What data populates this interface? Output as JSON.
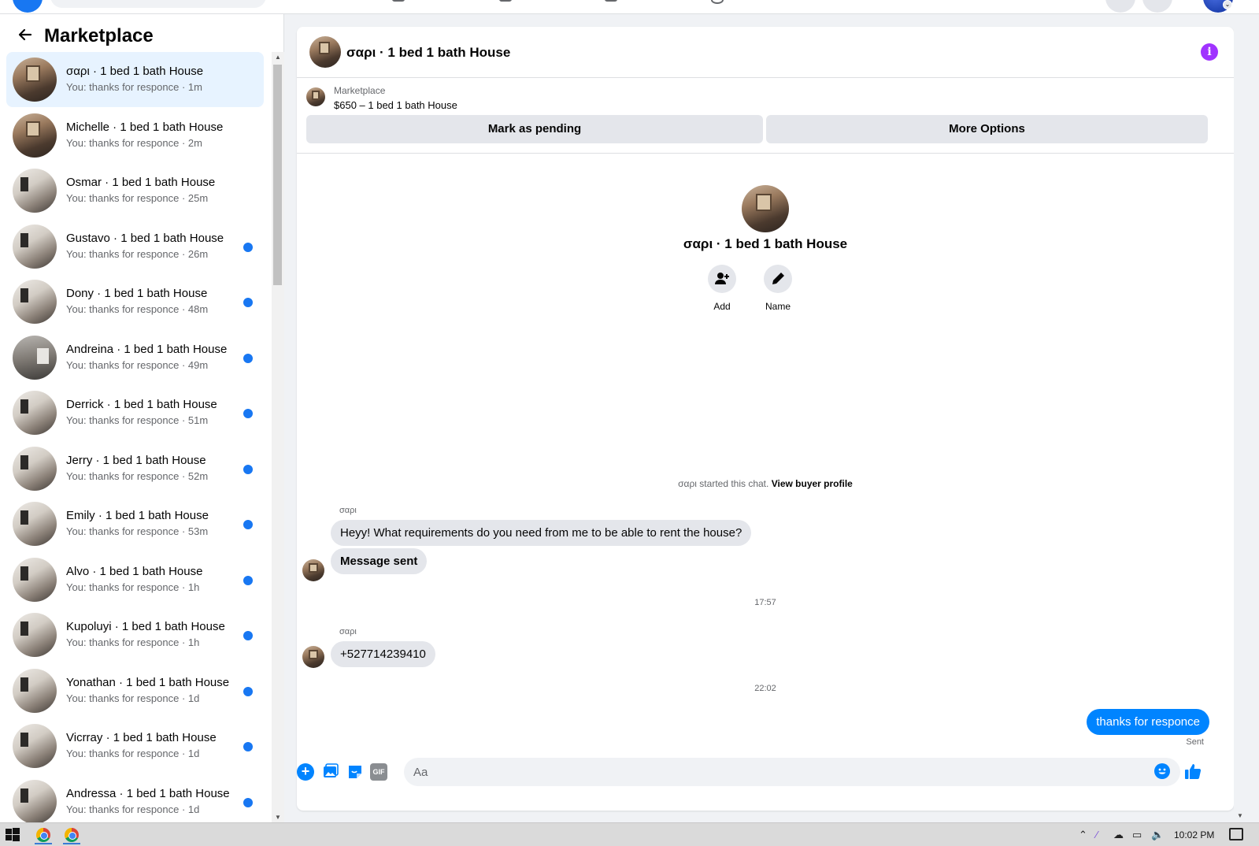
{
  "sidebar": {
    "title": "Marketplace",
    "conversations": [
      {
        "name": "σαρι · 1 bed 1 bath House",
        "preview": "You: thanks for responce",
        "time": "1m",
        "unread": false,
        "active": true,
        "img": "a"
      },
      {
        "name": "Michelle · 1 bed 1 bath House",
        "preview": "You: thanks for responce",
        "time": "2m",
        "unread": false,
        "active": false,
        "img": "a"
      },
      {
        "name": "Osmar · 1 bed 1 bath House",
        "preview": "You: thanks for responce",
        "time": "25m",
        "unread": false,
        "active": false,
        "img": "b"
      },
      {
        "name": "Gustavo · 1 bed 1 bath House",
        "preview": "You: thanks for responce",
        "time": "26m",
        "unread": true,
        "active": false,
        "img": "b"
      },
      {
        "name": "Dony · 1 bed 1 bath House",
        "preview": "You: thanks for responce",
        "time": "48m",
        "unread": true,
        "active": false,
        "img": "b"
      },
      {
        "name": "Andreina · 1 bed 1 bath House",
        "preview": "You: thanks for responce",
        "time": "49m",
        "unread": true,
        "active": false,
        "img": "c"
      },
      {
        "name": "Derrick · 1 bed 1 bath House",
        "preview": "You: thanks for responce",
        "time": "51m",
        "unread": true,
        "active": false,
        "img": "b"
      },
      {
        "name": "Jerry · 1 bed 1 bath House",
        "preview": "You: thanks for responce",
        "time": "52m",
        "unread": true,
        "active": false,
        "img": "b"
      },
      {
        "name": "Emily · 1 bed 1 bath House",
        "preview": "You: thanks for responce",
        "time": "53m",
        "unread": true,
        "active": false,
        "img": "b"
      },
      {
        "name": "Alvo · 1 bed 1 bath House",
        "preview": "You: thanks for responce",
        "time": "1h",
        "unread": true,
        "active": false,
        "img": "b"
      },
      {
        "name": "Kupoluyi · 1 bed 1 bath House",
        "preview": "You: thanks for responce",
        "time": "1h",
        "unread": true,
        "active": false,
        "img": "b"
      },
      {
        "name": "Yonathan · 1 bed 1 bath House",
        "preview": "You: thanks for responce",
        "time": "1d",
        "unread": true,
        "active": false,
        "img": "b"
      },
      {
        "name": "Vicrray · 1 bed 1 bath House",
        "preview": "You: thanks for responce",
        "time": "1d",
        "unread": true,
        "active": false,
        "img": "b"
      },
      {
        "name": "Andressa · 1 bed 1 bath House",
        "preview": "You: thanks for responce",
        "time": "1d",
        "unread": true,
        "active": false,
        "img": "b"
      }
    ]
  },
  "chat": {
    "title": "σαρι · 1 bed 1 bath House",
    "marketplace_label": "Marketplace",
    "listing": "$650 – 1 bed 1 bath House",
    "mark_pending_label": "Mark as pending",
    "more_options_label": "More Options",
    "profile_name": "σαρι · 1 bed 1 bath House",
    "add_label": "Add",
    "name_label": "Name",
    "started_text": "σαρι started this chat.",
    "view_profile_label": "View buyer profile",
    "sender_name": "σαρι",
    "msg1": "Heyy! What requirements do you need from me to be able to rent the house?",
    "msg2": "Message sent",
    "time1": "17:57",
    "msg3": "+527714239410",
    "time2": "22:02",
    "msg_out": "thanks for responce",
    "sent_label": "Sent",
    "composer_placeholder": "Aa",
    "gif_label": "GIF"
  },
  "taskbar": {
    "clock": "10:02 PM"
  },
  "colors": {
    "accent": "#0084ff",
    "unread_dot": "#1877f2",
    "info": "#a033ff",
    "active_bg": "#e7f3ff"
  }
}
